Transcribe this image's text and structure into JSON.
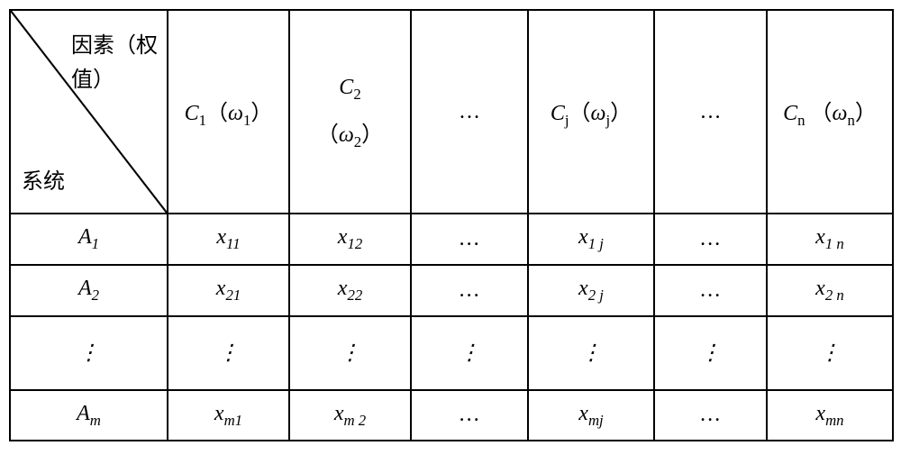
{
  "header": {
    "diag_top_l1": "因素（权",
    "diag_top_l2": "值）",
    "diag_bottom": "系统"
  },
  "cols": {
    "c1": "C",
    "c1_sub": "1",
    "c1_w": "ω",
    "c1_wsub": "1",
    "c2": "C",
    "c2_sub": "2",
    "c2_w": "ω",
    "c2_wsub": "2",
    "c3": "…",
    "cj": "C",
    "cj_sub": "j",
    "cj_w": "ω",
    "cj_wsub": "j",
    "c5": "…",
    "cn": "C",
    "cn_sub": "n",
    "cn_w": "ω",
    "cn_wsub": "n"
  },
  "rows": {
    "r1": {
      "label": "A",
      "lsub": "1",
      "c1": "x",
      "c1s": "11",
      "c2": "x",
      "c2s": "12",
      "c3": "…",
      "cj": "x",
      "cjs": "1 j",
      "c5": "…",
      "cn": "x",
      "cns": "1 n"
    },
    "r2": {
      "label": "A",
      "lsub": "2",
      "c1": "x",
      "c1s": "21",
      "c2": "x",
      "c2s": "22",
      "c3": "…",
      "cj": "x",
      "cjs": "2 j",
      "c5": "…",
      "cn": "x",
      "cns": "2 n"
    },
    "rv": {
      "v": "⋮"
    },
    "rm": {
      "label": "A",
      "lsub": "m",
      "c1": "x",
      "c1s": "m1",
      "c2": "x",
      "c2s": "m 2",
      "c3": "…",
      "cj": "x",
      "cjs": "mj",
      "c5": "…",
      "cn": "x",
      "cns": "mn"
    }
  },
  "chart_data": {
    "type": "table",
    "title": "Decision matrix with factor weights",
    "row_axis": "系统 (System)",
    "col_axis": "因素（权值） (Factor (Weight))",
    "columns": [
      "C1 (ω1)",
      "C2 (ω2)",
      "…",
      "Cj (ωj)",
      "…",
      "Cn (ωn)"
    ],
    "rows": [
      "A1",
      "A2",
      "⋮",
      "Am"
    ],
    "cells": [
      [
        "x11",
        "x12",
        "…",
        "x1j",
        "…",
        "x1n"
      ],
      [
        "x21",
        "x22",
        "…",
        "x2j",
        "…",
        "x2n"
      ],
      [
        "⋮",
        "⋮",
        "⋮",
        "⋮",
        "⋮",
        "⋮"
      ],
      [
        "xm1",
        "xm2",
        "…",
        "xmj",
        "…",
        "xmn"
      ]
    ]
  }
}
